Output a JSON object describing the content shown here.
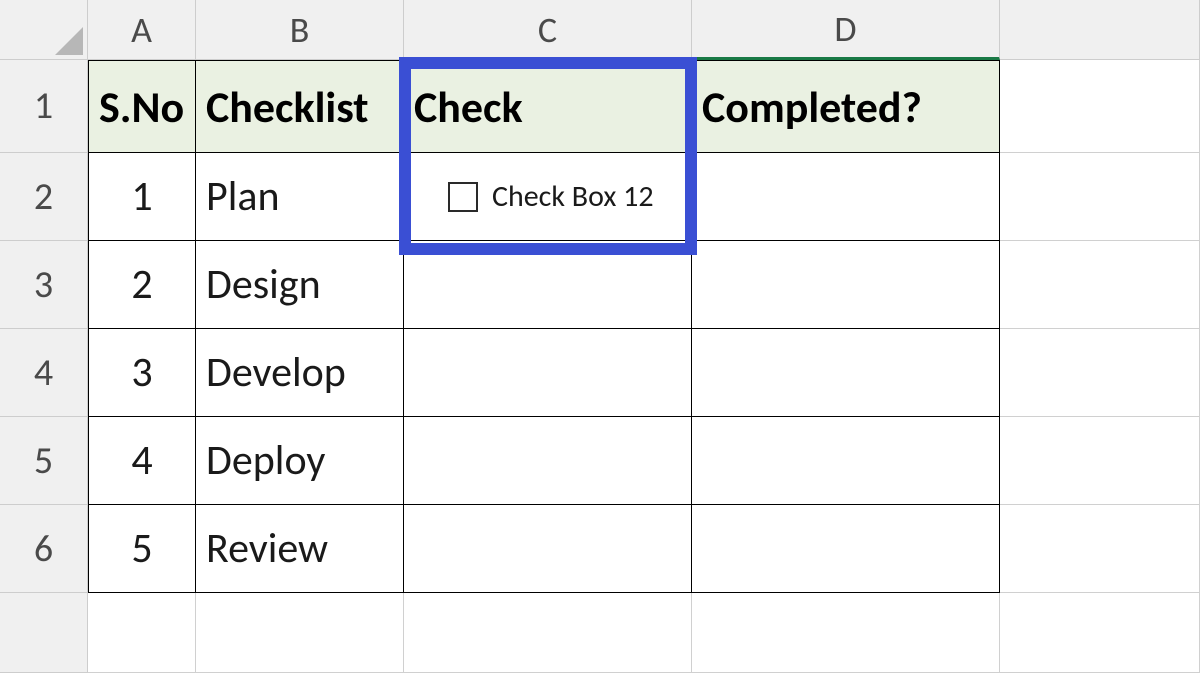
{
  "columns": [
    "A",
    "B",
    "C",
    "D"
  ],
  "rows": [
    "1",
    "2",
    "3",
    "4",
    "5",
    "6"
  ],
  "headers": {
    "A": "S.No",
    "B": "Checklist",
    "C": "Check",
    "D": "Completed?"
  },
  "data": [
    {
      "sno": "1",
      "checklist": "Plan"
    },
    {
      "sno": "2",
      "checklist": "Design"
    },
    {
      "sno": "3",
      "checklist": "Develop"
    },
    {
      "sno": "4",
      "checklist": "Deploy"
    },
    {
      "sno": "5",
      "checklist": "Review"
    }
  ],
  "checkbox": {
    "label": "Check Box 12",
    "checked": false
  }
}
